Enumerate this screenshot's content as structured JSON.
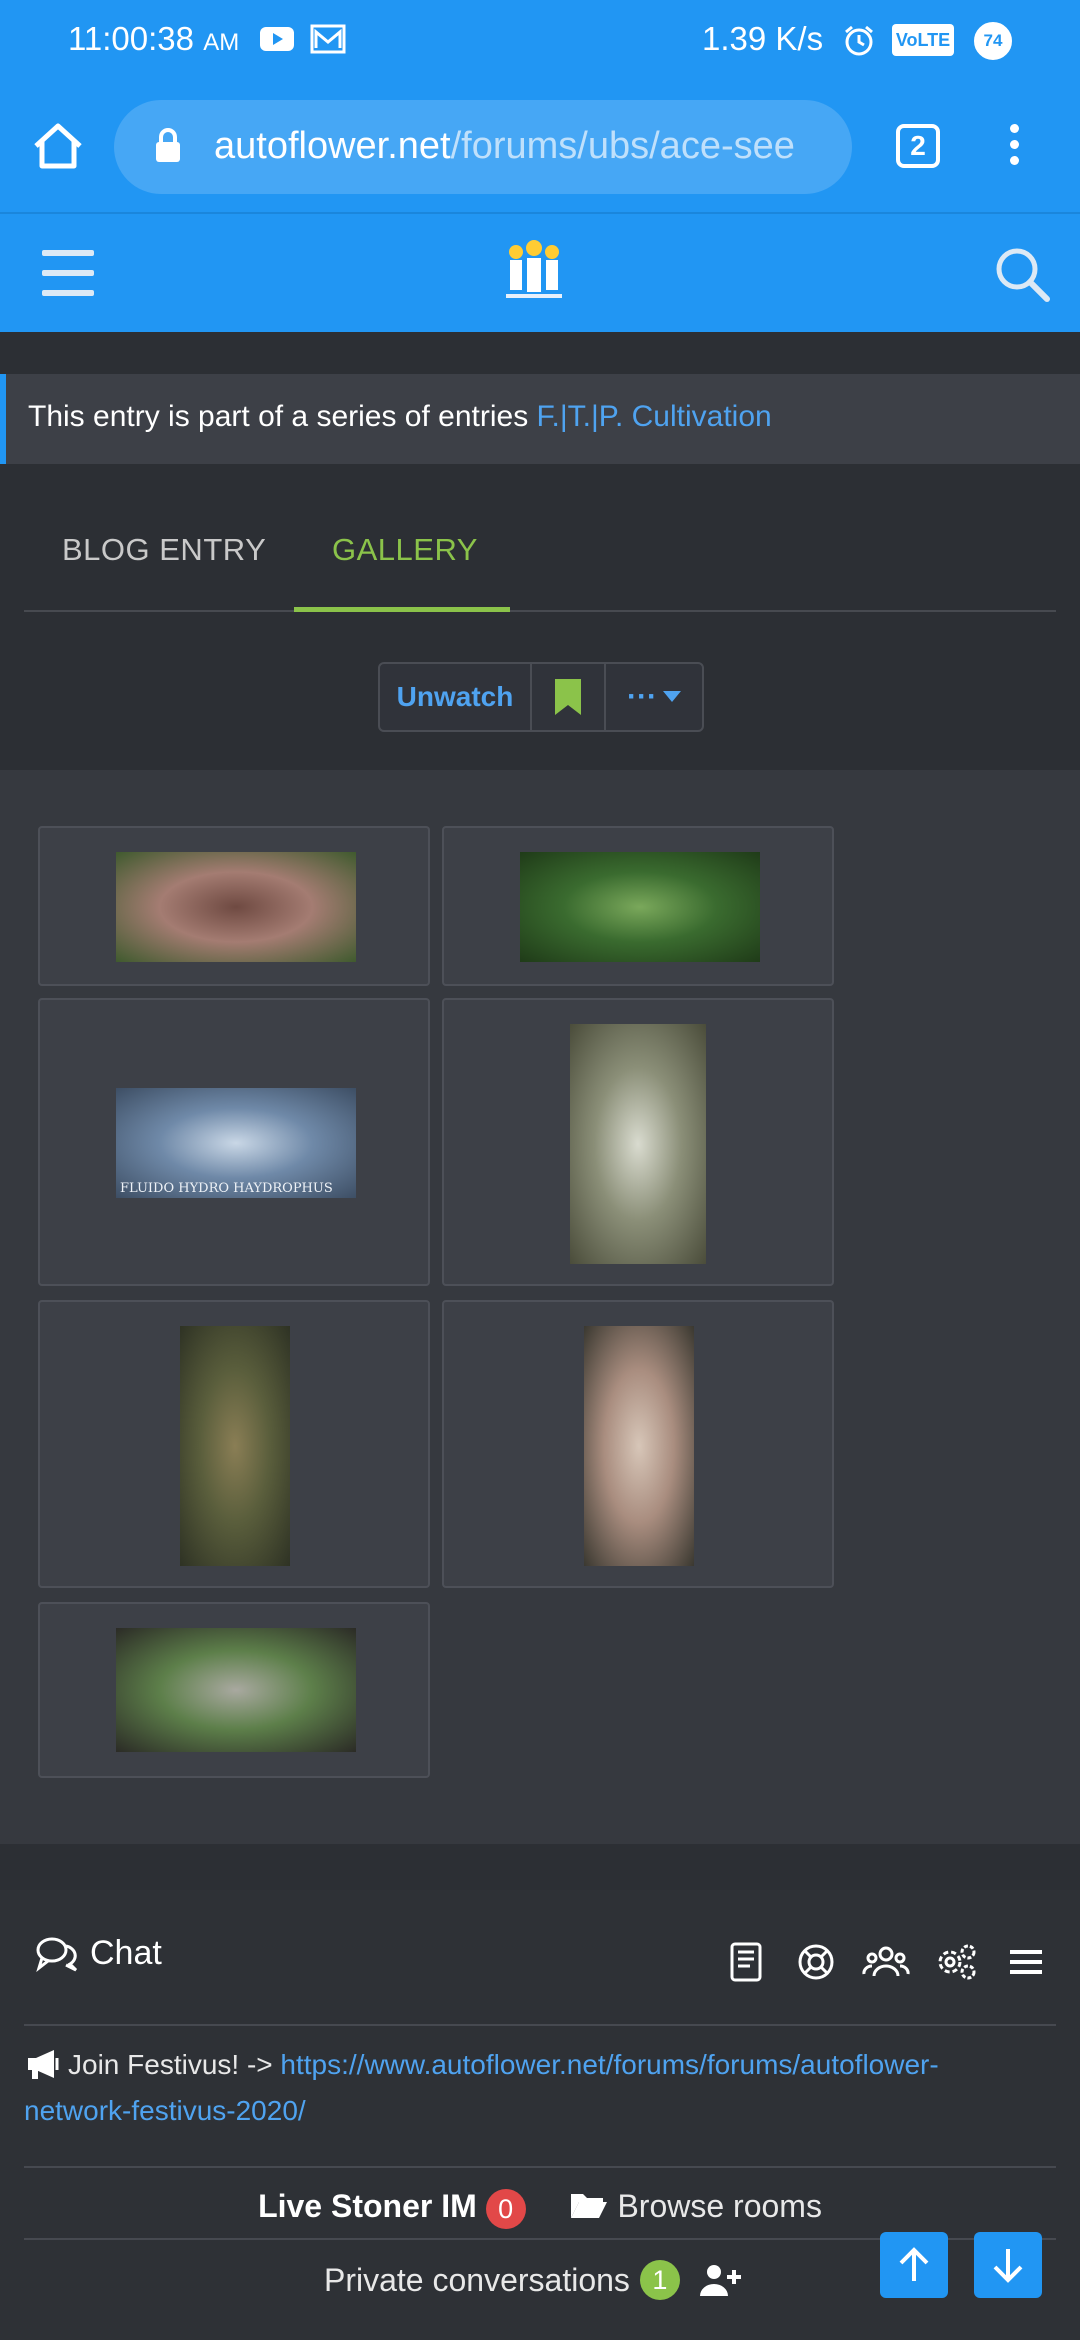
{
  "status_bar": {
    "time": "11:00:38",
    "ampm": "AM",
    "net_speed": "1.39 K/s",
    "volte": "VoLTE",
    "battery": "74"
  },
  "browser": {
    "url_host": "autoflower.net",
    "url_path": "/forums/ubs/ace-see",
    "tab_count": "2"
  },
  "notice": {
    "text": "This entry is part of a series of entries ",
    "link": "F.|T.|P. Cultivation"
  },
  "tabs": [
    {
      "label": "BLOG ENTRY"
    },
    {
      "label": "GALLERY"
    }
  ],
  "actions": {
    "unwatch": "Unwatch",
    "more": "···"
  },
  "gallery": {
    "images": [
      {
        "name": "seedling-soil",
        "colors": [
          "#a47c72",
          "#6f4a42",
          "#3f5a2e"
        ]
      },
      {
        "name": "leaf-closeup-green",
        "colors": [
          "#3a6b2f",
          "#7aa85b",
          "#1f3b18"
        ]
      },
      {
        "name": "blue-leaf-watermark",
        "colors": [
          "#6f89a8",
          "#c9d7e6",
          "#3d4e64"
        ],
        "watermark": "FLUIDO HYDRO HAYDROPHUS"
      },
      {
        "name": "trichome-leaf",
        "colors": [
          "#8b8f78",
          "#d9dbcf",
          "#4a4c3a"
        ]
      },
      {
        "name": "plant-dark-leaves",
        "colors": [
          "#5a5e3c",
          "#8a7e55",
          "#2e3224"
        ]
      },
      {
        "name": "bud-frosty",
        "colors": [
          "#a98d7f",
          "#d7c6b8",
          "#3a3830"
        ]
      },
      {
        "name": "grow-room",
        "colors": [
          "#5d7f4a",
          "#a9a9a0",
          "#2b2b26"
        ]
      }
    ]
  },
  "footer": {
    "chat_label": "Chat",
    "festivus_text": "Join Festivus! -> ",
    "festivus_link": "https://www.autoflower.net/forums/forums/autoflower-network-festivus-2020/",
    "im_label": "Live Stoner IM",
    "im_count": "0",
    "browse_rooms": "Browse rooms",
    "private_label": "Private conversations",
    "private_count": "1"
  }
}
